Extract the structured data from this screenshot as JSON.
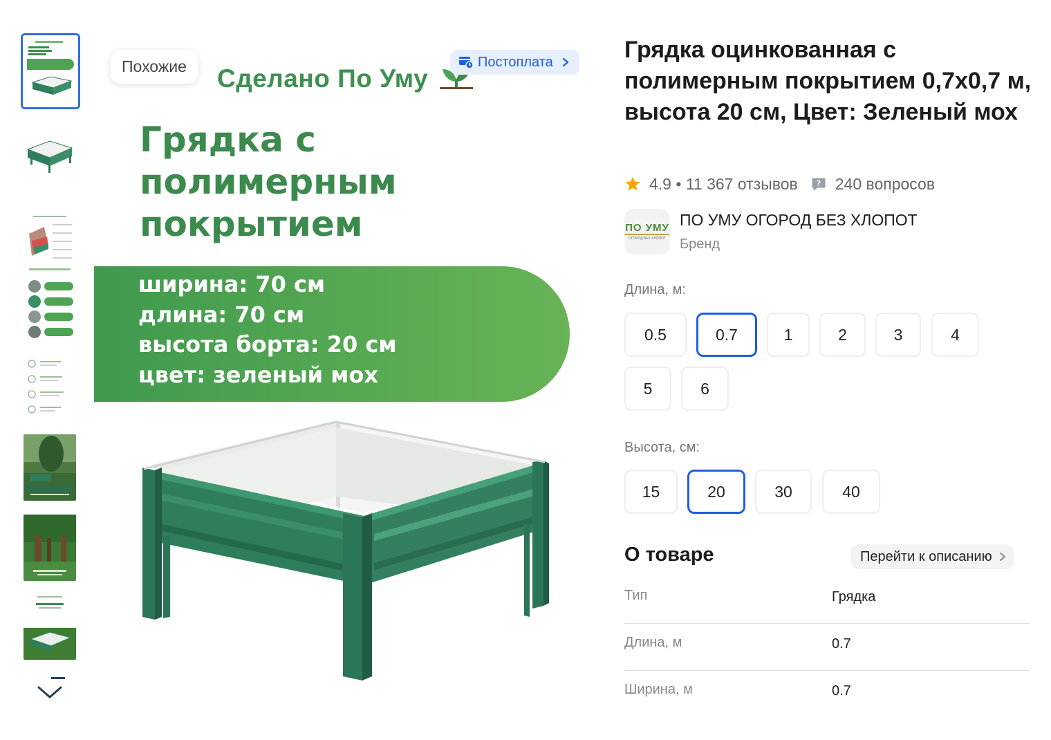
{
  "gallery": {
    "similar_label": "Похожие",
    "postpay_label": "Постоплата",
    "brand_line": "Сделано По Уму",
    "headline": [
      "Грядка с",
      "полимерным",
      "покрытием"
    ],
    "spec_lines": [
      "ширина: 70 см",
      "длина: 70 см",
      "высота борта: 20 см",
      "цвет: зеленый мох"
    ],
    "accent_color": "#3c8a4d"
  },
  "product": {
    "title": "Грядка оцинкованная с полимерным покрытием 0,7х0,7 м, высота 20 см, Цвет: Зеленый мох",
    "rating": "4.9",
    "reviews": "11 367 отзывов",
    "questions": "240 вопросов"
  },
  "brand": {
    "name": "ПО УМУ ОГОРОД БЕЗ ХЛОПОТ",
    "subtitle": "Бренд",
    "logo_text": "ПО УМУ",
    "logo_subtext": "ОГОРОД БЕЗ ХЛОПОТ"
  },
  "length_option": {
    "label": "Длина, м:",
    "values": [
      "0.5",
      "0.7",
      "1",
      "2",
      "3",
      "4",
      "5",
      "6"
    ],
    "selected": "0.7"
  },
  "height_option": {
    "label": "Высота, см:",
    "values": [
      "15",
      "20",
      "30",
      "40"
    ],
    "selected": "20"
  },
  "about": {
    "title": "О товаре",
    "goto_label": "Перейти к описанию",
    "rows": [
      {
        "key": "Тип",
        "value": "Грядка"
      },
      {
        "key": "Длина, м",
        "value": "0.7"
      },
      {
        "key": "Ширина, м",
        "value": "0.7"
      }
    ]
  },
  "colors": {
    "selected_border": "#1f5fe0",
    "star": "#f7a600",
    "green": "#2e7d5b"
  }
}
